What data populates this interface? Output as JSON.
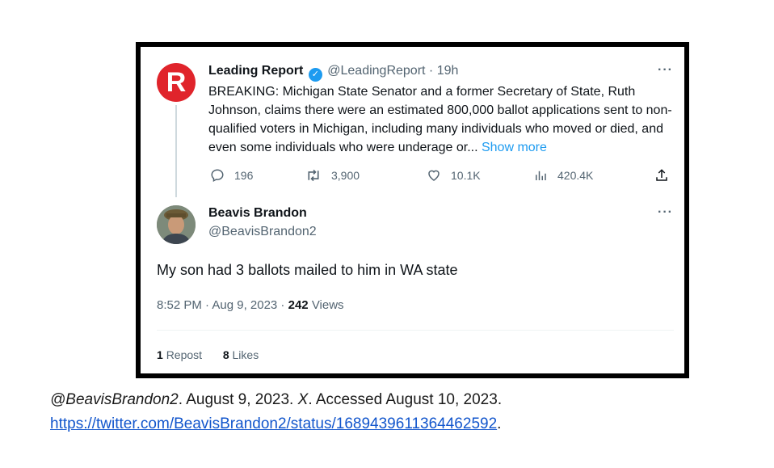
{
  "tweet1": {
    "name": "Leading Report",
    "handle": "@LeadingReport",
    "separator": "·",
    "time": "19h",
    "more": "···",
    "avatar_letter": "R",
    "text": "BREAKING: Michigan State Senator and a former Secretary of State, Ruth Johnson, claims there were an estimated 800,000 ballot applications sent to non-qualified voters in Michigan, including many individuals who moved or died, and even some individuals who were underage or...",
    "show_more": "Show more",
    "replies": "196",
    "reposts": "3,900",
    "likes": "10.1K",
    "views": "420.4K"
  },
  "tweet2": {
    "name": "Beavis Brandon",
    "handle": "@BeavisBrandon2",
    "more": "···",
    "text": "My son had 3 ballots mailed to him in WA state",
    "time": "8:52 PM · Aug 9, 2023 ·",
    "views_count": "242",
    "views_label": "Views",
    "repost_count": "1",
    "repost_label": "Repost",
    "likes_count": "8",
    "likes_label": "Likes"
  },
  "caption": {
    "handle": "@BeavisBrandon2",
    "text_1": ". August 9, 2023.",
    "site": "X",
    "text_2": ". Accessed August 10, 2023.",
    "url": "https://twitter.com/BeavisBrandon2/status/1689439611364462592",
    "end": "."
  },
  "colors": {
    "brand_red": "#e0242b",
    "verified_blue": "#1d9bf0",
    "link_blue": "#1155cc",
    "muted_grey": "#536471"
  }
}
